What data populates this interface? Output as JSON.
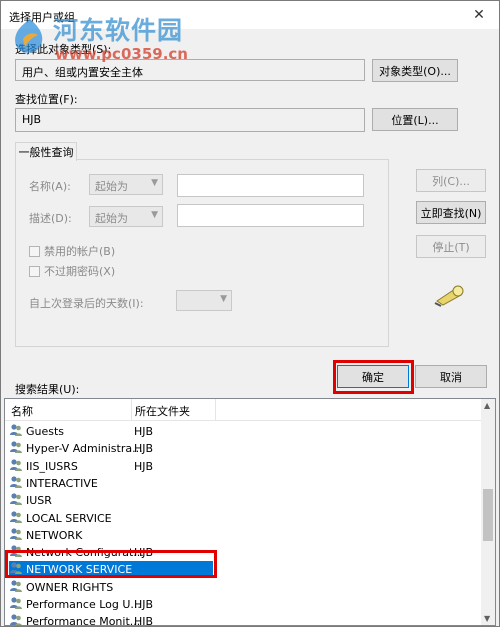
{
  "window": {
    "title": "选择用户或组",
    "close_glyph": "✕"
  },
  "watermark": {
    "site_name": "河东软件园",
    "url": "www.pc0359.cn"
  },
  "object_type": {
    "label": "选择此对象类型(S):",
    "value": "用户、组或内置安全主体",
    "button": "对象类型(O)..."
  },
  "location": {
    "label": "查找位置(F):",
    "value": "HJB",
    "button": "位置(L)..."
  },
  "query": {
    "tab_label": "一般性查询",
    "name_label": "名称(A):",
    "name_mode": "起始为",
    "desc_label": "描述(D):",
    "desc_mode": "起始为",
    "disabled_accounts": "禁用的帐户(B)",
    "non_expiring_pw": "不过期密码(X)",
    "days_since_login": "自上次登录后的天数(I):"
  },
  "buttons": {
    "columns": "列(C)...",
    "find_now": "立即查找(N)",
    "stop": "停止(T)",
    "ok": "确定",
    "cancel": "取消"
  },
  "results": {
    "label": "搜索结果(U):",
    "col_name": "名称",
    "col_folder": "所在文件夹",
    "rows": [
      {
        "name": "Guests",
        "folder": "HJB"
      },
      {
        "name": "Hyper-V Administra...",
        "folder": "HJB"
      },
      {
        "name": "IIS_IUSRS",
        "folder": "HJB"
      },
      {
        "name": "INTERACTIVE",
        "folder": ""
      },
      {
        "name": "IUSR",
        "folder": ""
      },
      {
        "name": "LOCAL SERVICE",
        "folder": ""
      },
      {
        "name": "NETWORK",
        "folder": ""
      },
      {
        "name": "Network Configurat...",
        "folder": "HJB"
      },
      {
        "name": "NETWORK SERVICE",
        "folder": ""
      },
      {
        "name": "OWNER RIGHTS",
        "folder": ""
      },
      {
        "name": "Performance Log U...",
        "folder": "HJB"
      },
      {
        "name": "Performance Monit...",
        "folder": "HJB"
      }
    ],
    "selected": "NETWORK SERVICE"
  },
  "colors": {
    "selection": "#0078d7",
    "highlight_box": "#e00000"
  }
}
